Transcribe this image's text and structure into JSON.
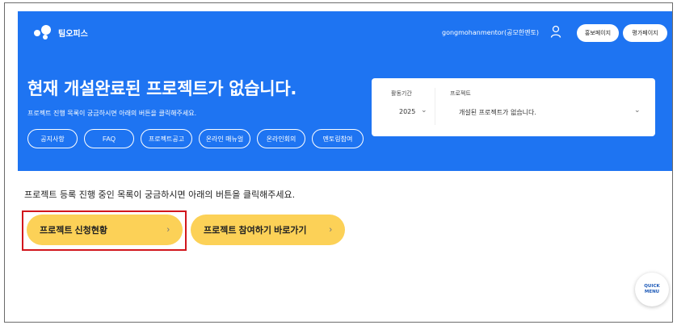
{
  "brand": {
    "name": "팀오피스"
  },
  "header": {
    "username": "gongmohanmentor(공모한멘토)",
    "buttons": [
      "홍보페이지",
      "평가페이지"
    ]
  },
  "hero": {
    "title": "현재 개설완료된 프로젝트가 없습니다.",
    "subtitle": "프로젝트 진행 목록이 궁금하시면 아래의 버튼을 클릭해주세요.",
    "pills": [
      "공지사항",
      "FAQ",
      "프로젝트공고",
      "온라인 매뉴얼",
      "온라인회의",
      "멘토링참여"
    ]
  },
  "filter": {
    "period_label": "활동기간",
    "period_value": "2025",
    "project_label": "프로젝트",
    "project_value": "개설된 프로젝트가 없습니다."
  },
  "main": {
    "notice": "프로젝트 등록 진행 중인 목록이 궁금하시면 아래의 버튼을 클릭해주세요.",
    "cta": [
      {
        "label": "프로젝트 신청현황",
        "highlighted": true
      },
      {
        "label": "프로젝트 참여하기 바로가기",
        "highlighted": false
      }
    ]
  },
  "quick_menu": {
    "line1": "QUICK",
    "line2": "MENU"
  },
  "colors": {
    "hero": "#1e74f2",
    "cta": "#fcd157",
    "highlight": "#d1161d"
  }
}
